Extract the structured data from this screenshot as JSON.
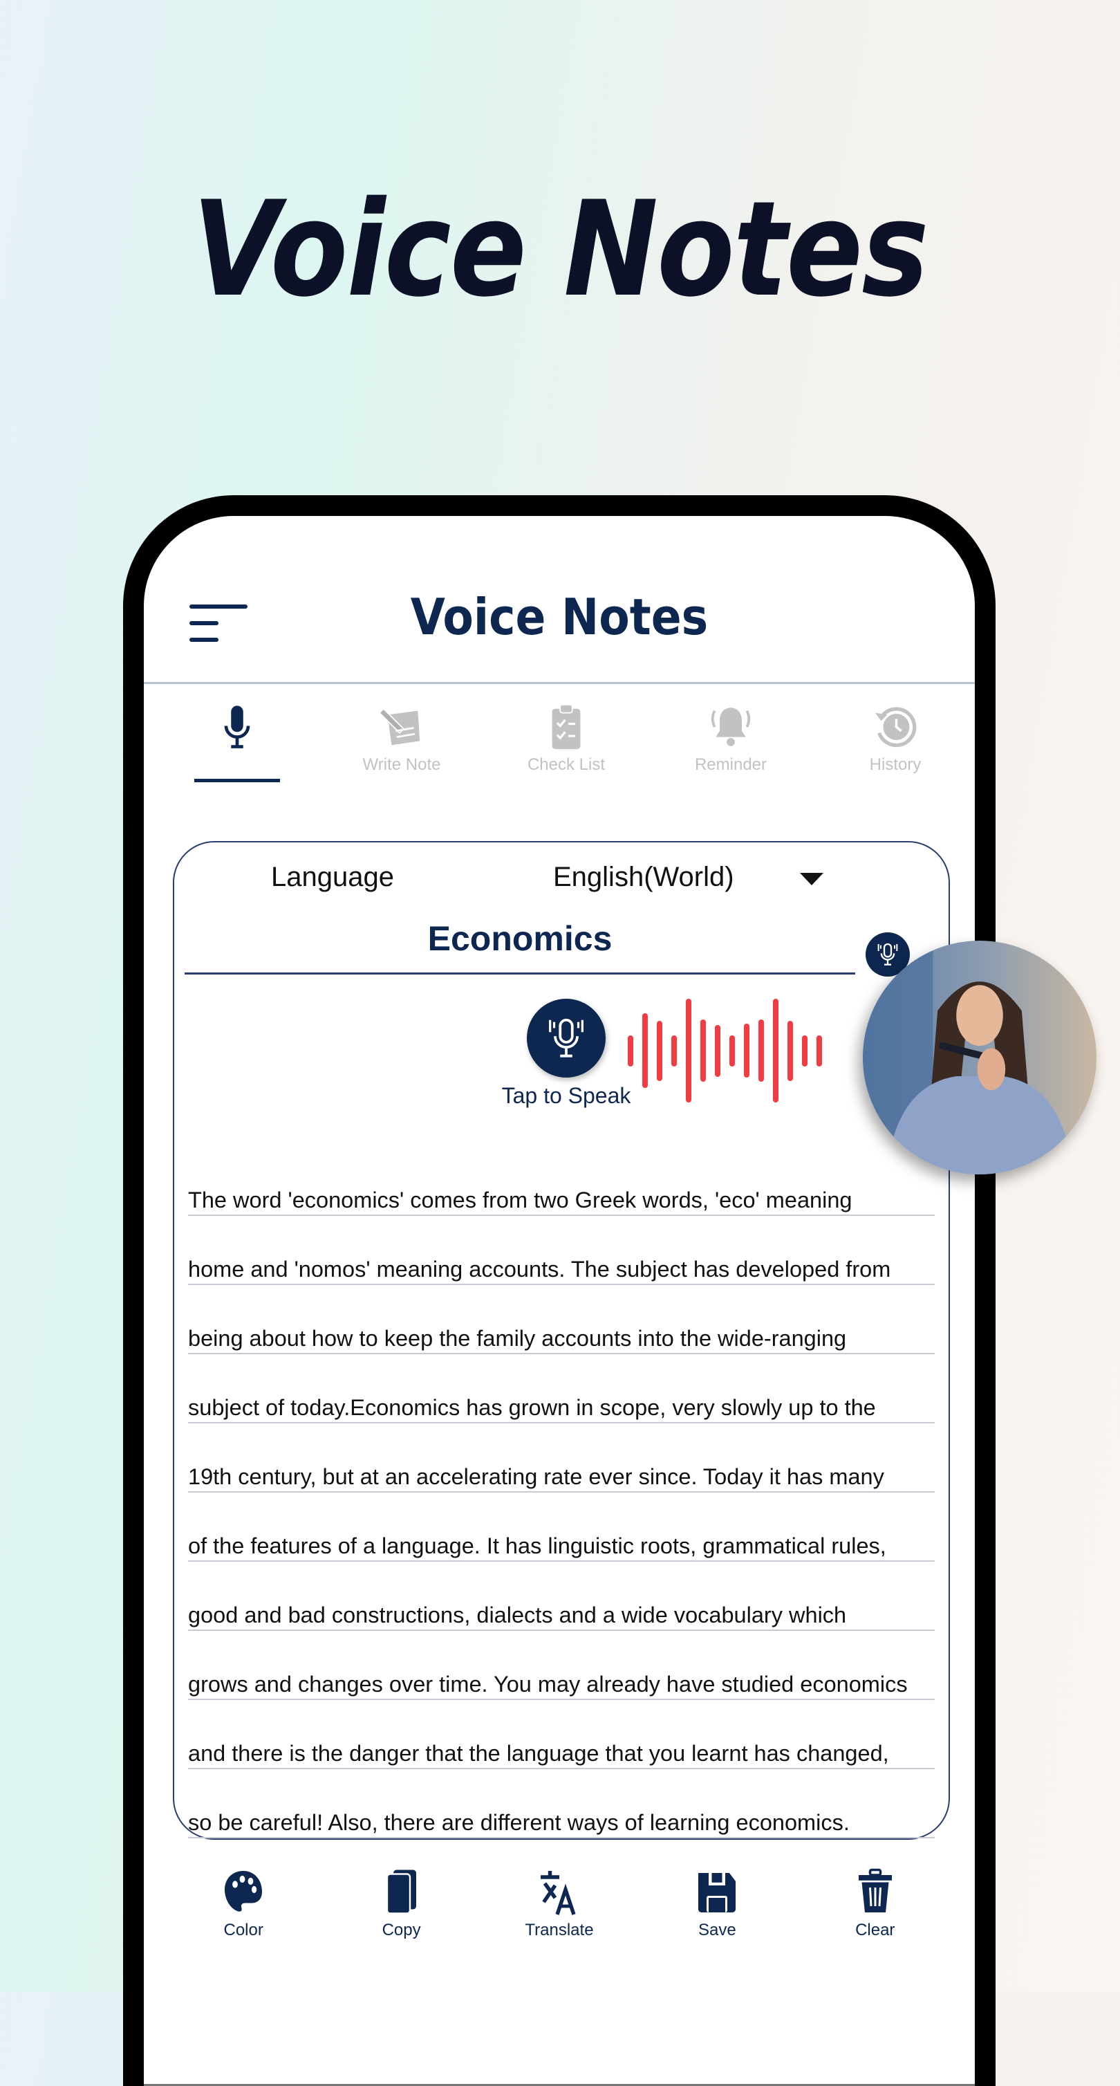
{
  "hero": {
    "title": "Voice Notes"
  },
  "app": {
    "title": "Voice Notes",
    "menu_icon": "hamburger-menu-icon"
  },
  "tabs": [
    {
      "label": "",
      "icon": "microphone-icon",
      "active": true
    },
    {
      "label": "Write Note",
      "icon": "write-note-icon",
      "active": false
    },
    {
      "label": "Check List",
      "icon": "checklist-icon",
      "active": false
    },
    {
      "label": "Reminder",
      "icon": "bell-icon",
      "active": false
    },
    {
      "label": "History",
      "icon": "history-icon",
      "active": false
    }
  ],
  "editor": {
    "language_label": "Language",
    "language_value": "English(World)",
    "note_title": "Economics",
    "speak_label": "Tap to Speak",
    "waveform_levels": [
      0.3,
      0.72,
      0.58,
      0.3,
      1.0,
      0.6,
      0.5,
      0.3,
      0.52,
      0.6,
      1.0,
      0.58,
      0.3,
      0.3
    ],
    "lines": [
      "The word 'economics' comes from two Greek words, 'eco' meaning",
      "home and 'nomos' meaning accounts. The subject has developed from",
      "being about how to keep the family accounts into the wide-ranging",
      "subject of today.Economics has grown in scope, very slowly up to the",
      "19th century, but at an accelerating rate ever since. Today it has many",
      "of the features of a language. It has linguistic roots, grammatical rules,",
      "good and bad constructions, dialects and a wide vocabulary which",
      "grows and changes over time. You may already have studied economics",
      "and there is the danger that the language that you learnt has changed,",
      "so be careful! Also, there are different ways of learning economics."
    ]
  },
  "photo": {
    "description": "woman speaking into smartphone"
  },
  "toolbar": [
    {
      "label": "Color",
      "icon": "palette-icon"
    },
    {
      "label": "Copy",
      "icon": "copy-icon"
    },
    {
      "label": "Translate",
      "icon": "translate-icon"
    },
    {
      "label": "Save",
      "icon": "save-icon"
    },
    {
      "label": "Clear",
      "icon": "trash-icon"
    }
  ],
  "colors": {
    "primary": "#0d2750",
    "inactive": "#c2c2c2",
    "wave": "#f03c42"
  }
}
